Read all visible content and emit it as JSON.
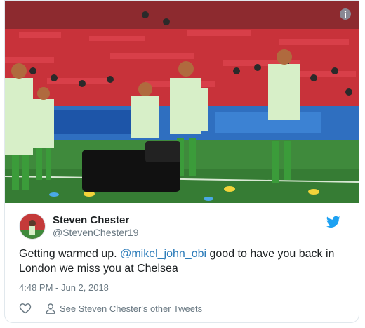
{
  "media": {
    "icon": "info-icon"
  },
  "author": {
    "name": "Steven Chester",
    "handle": "@StevenChester19"
  },
  "tweet": {
    "text_before": "Getting warmed up. ",
    "mention": "@mikel_john_obi",
    "text_after": " good to have you back in London we miss you at Chelsea",
    "timestamp": "4:48 PM - Jun 2, 2018"
  },
  "actions": {
    "like_icon": "heart-icon",
    "profile_icon": "person-icon",
    "other_tweets_label": "See Steven Chester's other Tweets"
  },
  "colors": {
    "twitter_blue": "#1da1f2",
    "mention": "#2b7bb9",
    "secondary_text": "#697882"
  }
}
